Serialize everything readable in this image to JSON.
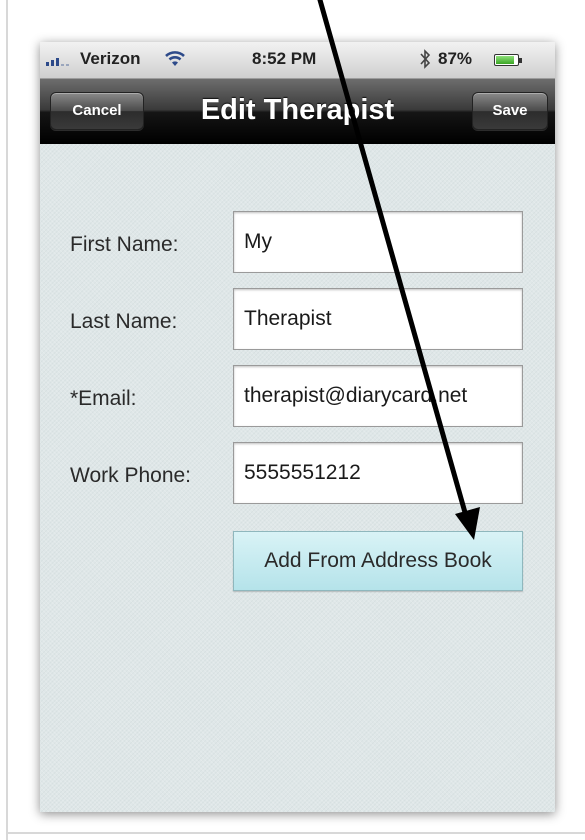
{
  "status_bar": {
    "carrier": "Verizon",
    "time": "8:52 PM",
    "battery_percent": "87%",
    "battery_level": 0.87,
    "icons": [
      "signal-icon",
      "wifi-icon",
      "bluetooth-icon",
      "battery-icon"
    ]
  },
  "nav": {
    "title": "Edit Therapist",
    "cancel_label": "Cancel",
    "save_label": "Save"
  },
  "form": {
    "fields": [
      {
        "label": "First Name:",
        "value": "My"
      },
      {
        "label": "Last Name:",
        "value": "Therapist"
      },
      {
        "label": "*Email:",
        "value": "therapist@diarycard.net"
      },
      {
        "label": "Work Phone:",
        "value": "5555551212"
      }
    ],
    "address_book_label": "Add From Address Book"
  },
  "colors": {
    "nav_bar": "#1a1a1a",
    "content_bg": "#dfe7e8",
    "address_button": "#c4ebf0",
    "annotation_arrow": "#000000"
  }
}
